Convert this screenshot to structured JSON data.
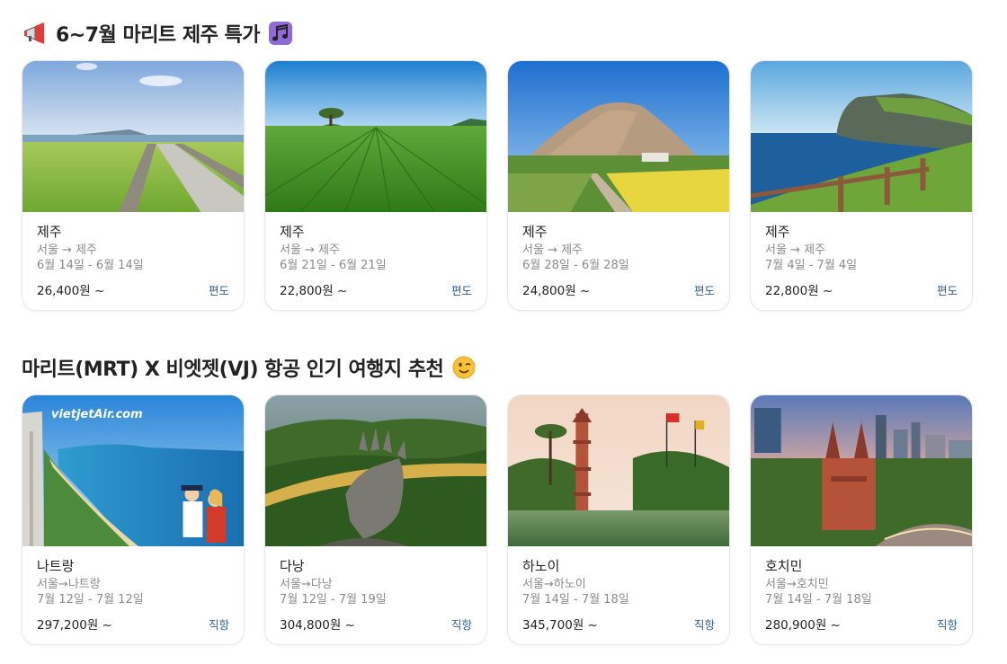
{
  "section1": {
    "title": "6~7월 마리트 제주 특가",
    "lead_icon": "megaphone-icon",
    "trail_icon": "music-notes-icon",
    "cards": [
      {
        "city": "제주",
        "route": "서울 → 제주",
        "dates": "6월 14일 - 6월 14일",
        "price": "26,400원 ~",
        "tag": "편도",
        "image": "jeju-green-fields"
      },
      {
        "city": "제주",
        "route": "서울 → 제주",
        "dates": "6월 21일 - 6월 21일",
        "price": "22,800원 ~",
        "tag": "편도",
        "image": "jeju-tea-field"
      },
      {
        "city": "제주",
        "route": "서울 → 제주",
        "dates": "6월 28일 - 6월 28일",
        "price": "24,800원 ~",
        "tag": "편도",
        "image": "sanbangsan-mountain"
      },
      {
        "city": "제주",
        "route": "서울 → 제주",
        "dates": "7월 4일 - 7월 4일",
        "price": "22,800원 ~",
        "tag": "편도",
        "image": "seopjikoji-coast"
      }
    ]
  },
  "section2": {
    "title": "마리트(MRT) X 비엣젯(VJ) 항공 인기 여행지 추천",
    "trail_icon": "winking-face-icon",
    "cards": [
      {
        "city": "나트랑",
        "route": "서울→나트랑",
        "dates": "7월 12일 - 7월 12일",
        "price": "297,200원 ~",
        "tag": "직항",
        "image": "nha-trang-beach",
        "brand_text": "vietjetAir.com"
      },
      {
        "city": "다낭",
        "route": "서울→다낭",
        "dates": "7월 12일 - 7월 19일",
        "price": "304,800원 ~",
        "tag": "직항",
        "image": "golden-bridge-hands"
      },
      {
        "city": "하노이",
        "route": "서울→하노이",
        "dates": "7월 14일 - 7월 18일",
        "price": "345,700원 ~",
        "tag": "직항",
        "image": "tran-quoc-pagoda"
      },
      {
        "city": "호치민",
        "route": "서울→호치민",
        "dates": "7월 14일 - 7월 18일",
        "price": "280,900원 ~",
        "tag": "직항",
        "image": "saigon-cathedral"
      }
    ]
  }
}
